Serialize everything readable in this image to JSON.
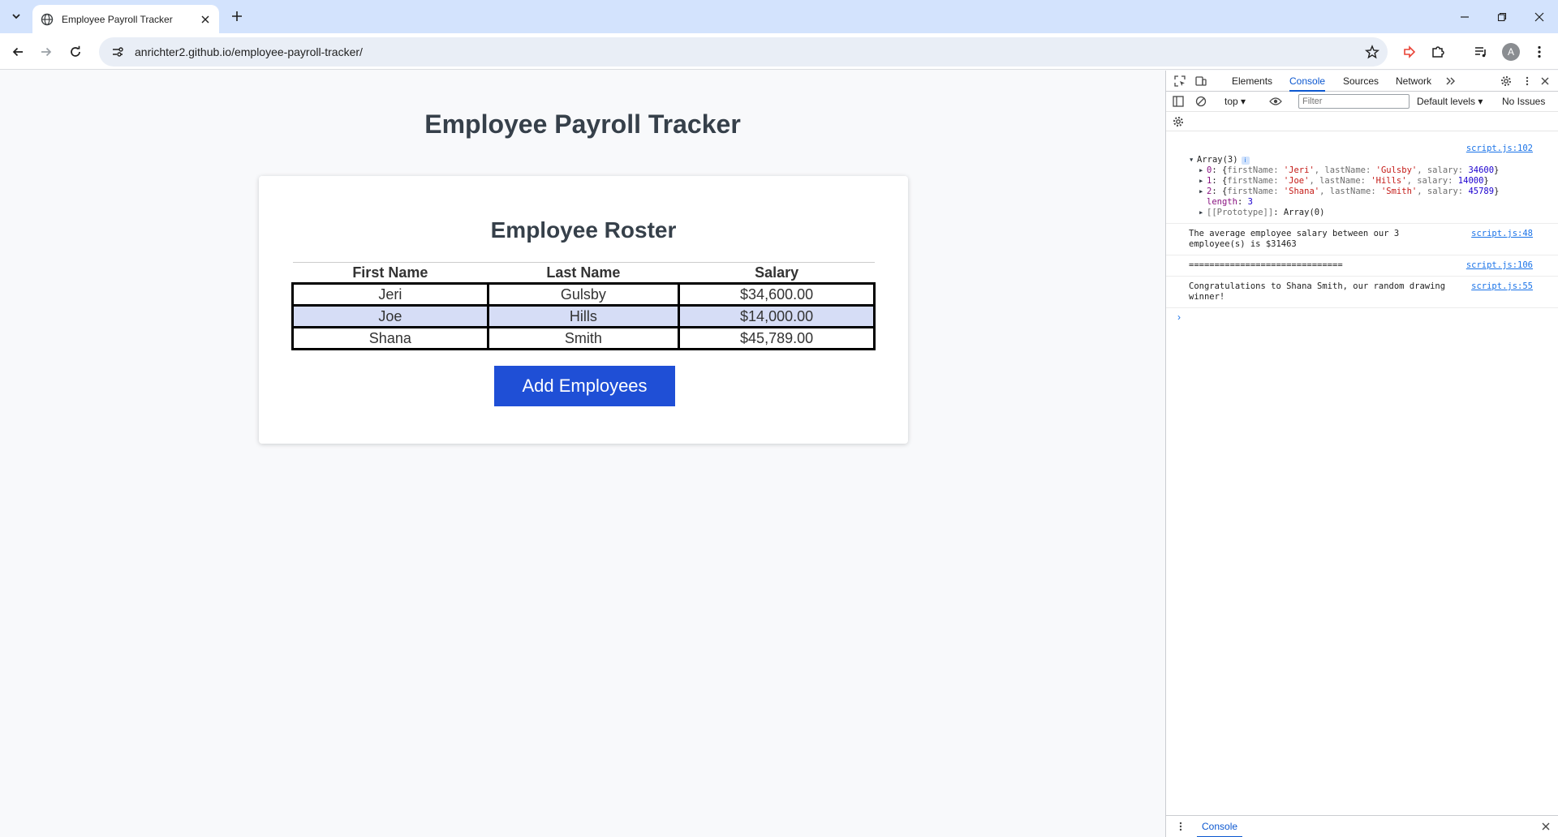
{
  "browser": {
    "tab_title": "Employee Payroll Tracker",
    "url": "anrichter2.github.io/employee-payroll-tracker/",
    "profile_initial": "A"
  },
  "page": {
    "title": "Employee Payroll Tracker",
    "roster_heading": "Employee Roster",
    "columns": [
      "First Name",
      "Last Name",
      "Salary"
    ],
    "rows": [
      [
        "Jeri",
        "Gulsby",
        "$34,600.00"
      ],
      [
        "Joe",
        "Hills",
        "$14,000.00"
      ],
      [
        "Shana",
        "Smith",
        "$45,789.00"
      ]
    ],
    "add_button": "Add Employees"
  },
  "devtools": {
    "tabs": [
      "Elements",
      "Console",
      "Sources",
      "Network"
    ],
    "active_tab": "Console",
    "context": "top",
    "filter_placeholder": "Filter",
    "levels": "Default levels",
    "issues": "No Issues",
    "drawer_tab": "Console",
    "messages": {
      "array": {
        "source": "script.js:102",
        "header": "Array(3)",
        "items": [
          {
            "index": "0",
            "firstName": "'Jeri'",
            "lastName": "'Gulsby'",
            "salary": "34600"
          },
          {
            "index": "1",
            "firstName": "'Joe'",
            "lastName": "'Hills'",
            "salary": "14000"
          },
          {
            "index": "2",
            "firstName": "'Shana'",
            "lastName": "'Smith'",
            "salary": "45789"
          }
        ],
        "length_label": "length",
        "length_value": "3",
        "prototype_label": "[[Prototype]]",
        "prototype_value": "Array(0)"
      },
      "average": {
        "source": "script.js:48",
        "line1": "The average employee salary between our 3",
        "line2": "employee(s) is $31463"
      },
      "separator": {
        "source": "script.js:106",
        "text": "=============================="
      },
      "winner": {
        "source": "script.js:55",
        "line1": "Congratulations to Shana Smith, our random drawing",
        "line2": "winner!"
      }
    }
  },
  "colors": {
    "tabstrip": "#d3e3fd",
    "primary_button": "#1f4fd6",
    "alt_row": "#d6ddf6",
    "devtools_accent": "#0b57d0"
  }
}
